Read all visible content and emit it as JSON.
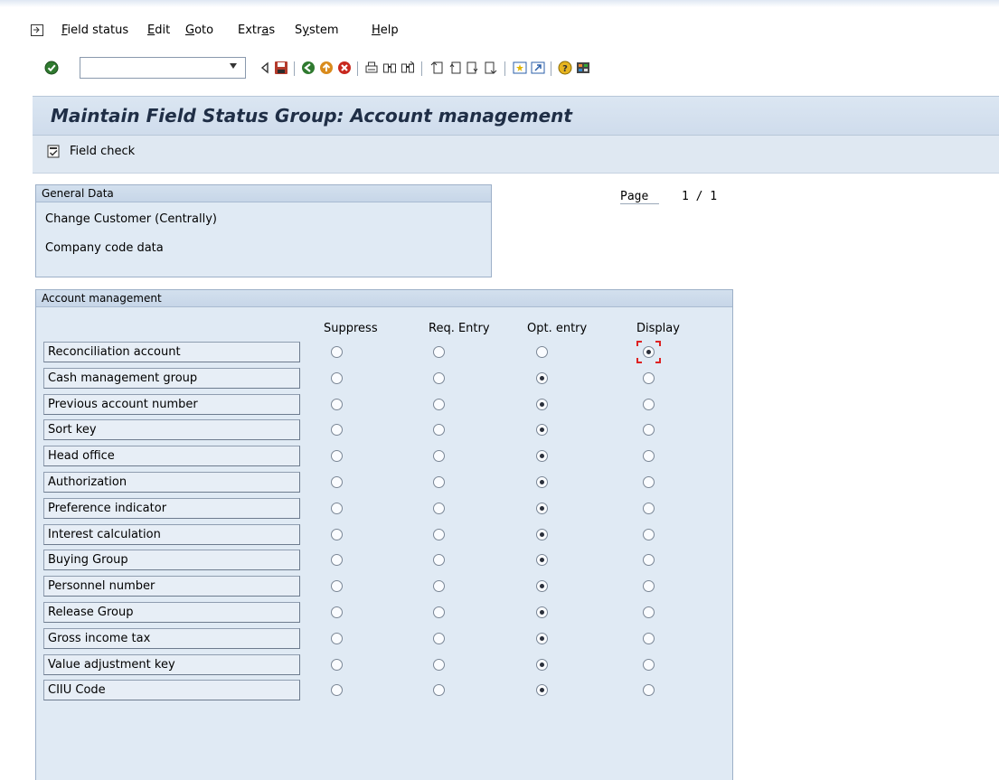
{
  "menu": {
    "items": [
      {
        "label": "Field status"
      },
      {
        "label": "Edit"
      },
      {
        "label": "Goto"
      },
      {
        "label": "Extras"
      },
      {
        "label": "System"
      },
      {
        "label": "Help"
      }
    ]
  },
  "toolbar": {
    "command_value": "",
    "icons": [
      "enter-icon",
      "back-arrow-icon",
      "save-icon",
      "back-icon",
      "exit-icon",
      "cancel-icon",
      "print-icon",
      "find-icon",
      "find-next-icon",
      "first-page-icon",
      "previous-page-icon",
      "next-page-icon",
      "last-page-icon",
      "create-session-icon",
      "shortcut-icon",
      "help-icon",
      "layout-icon"
    ]
  },
  "title": "Maintain Field Status Group: Account management",
  "app_toolbar": {
    "field_check_label": "Field check"
  },
  "general_data": {
    "header": "General Data",
    "line1": "Change Customer (Centrally)",
    "line2": "Company code data"
  },
  "page": {
    "label": "Page",
    "value": "1 / 1"
  },
  "account_management": {
    "header": "Account management",
    "columns": [
      "Suppress",
      "Req. Entry",
      "Opt. entry",
      "Display"
    ],
    "rows": [
      {
        "label": "Reconciliation account",
        "selected": 3
      },
      {
        "label": "Cash management group",
        "selected": 2
      },
      {
        "label": "Previous account number",
        "selected": 2
      },
      {
        "label": "Sort key",
        "selected": 2
      },
      {
        "label": "Head office",
        "selected": 2
      },
      {
        "label": "Authorization",
        "selected": 2
      },
      {
        "label": "Preference indicator",
        "selected": 2
      },
      {
        "label": "Interest calculation",
        "selected": 2
      },
      {
        "label": "Buying Group",
        "selected": 2
      },
      {
        "label": "Personnel number",
        "selected": 2
      },
      {
        "label": "Release Group",
        "selected": 2
      },
      {
        "label": "Gross income tax",
        "selected": 2
      },
      {
        "label": "Value adjustment key",
        "selected": 2
      },
      {
        "label": "CIIU Code",
        "selected": 2
      }
    ]
  },
  "colors": {
    "title_text": "#1f2e46",
    "panel_bg": "#e0eaf4",
    "focus": "#dd2222"
  }
}
